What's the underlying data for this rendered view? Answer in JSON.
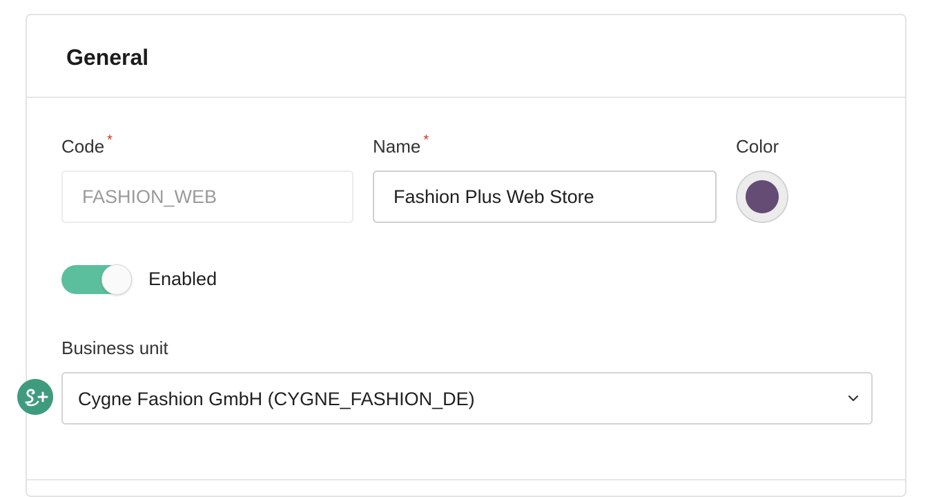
{
  "section": {
    "title": "General"
  },
  "fields": {
    "code": {
      "label": "Code",
      "required_mark": "*",
      "value": "FASHION_WEB"
    },
    "name": {
      "label": "Name",
      "required_mark": "*",
      "value": "Fashion Plus Web Store"
    },
    "color": {
      "label": "Color",
      "value": "#654c75"
    },
    "enabled": {
      "label": "Enabled",
      "checked": true
    },
    "business_unit": {
      "label": "Business unit",
      "selected": "Cygne Fashion GmbH (CYGNE_FASHION_DE)"
    }
  },
  "colors": {
    "toggle_on": "#5bbf9d",
    "accent": "#3f9b7e",
    "required": "#d0342c"
  },
  "icons": {
    "select_caret": "chevron-down-icon",
    "floating_action": "swan-plus-icon"
  }
}
